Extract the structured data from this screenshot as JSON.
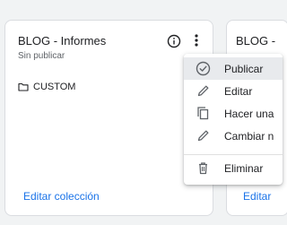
{
  "cards": [
    {
      "title": "BLOG - Informes",
      "status": "Sin publicar",
      "items": [
        {
          "icon": "folder-icon",
          "label": "CUSTOM"
        }
      ],
      "link": "Editar colección"
    },
    {
      "title": "BLOG -",
      "link": "Editar"
    }
  ],
  "menu": {
    "items": [
      {
        "icon": "check-circle-icon",
        "label": "Publicar",
        "selected": true
      },
      {
        "icon": "pencil-icon",
        "label": "Editar"
      },
      {
        "icon": "copy-icon",
        "label": "Hacer una"
      },
      {
        "icon": "pencil-icon",
        "label": "Cambiar n"
      },
      {
        "icon": "trash-icon",
        "label": "Eliminar"
      }
    ]
  },
  "colors": {
    "link": "#1a73e8",
    "text": "#202124",
    "muted": "#5f6368",
    "icon": "#5f6368",
    "selected_bg": "#e8eaed",
    "page_bg": "#f1f3f4"
  }
}
